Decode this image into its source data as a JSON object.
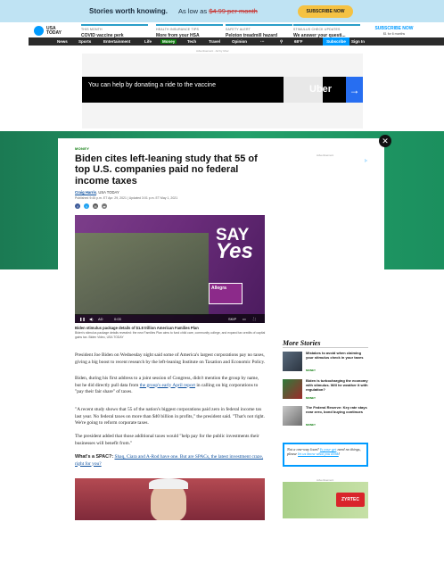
{
  "promo": {
    "headline": "Stories worth knowing.",
    "price_prefix": "As low as",
    "price": "$4.99 per month",
    "cta": "SUBSCRIBE NOW"
  },
  "header": {
    "logo_text": "USA TODAY",
    "headlines": [
      {
        "kicker": "THIS MONTH",
        "title": "COVID vaccine perk"
      },
      {
        "kicker": "HEALTH INSURANCE TIPS",
        "title": "More from your HSA"
      },
      {
        "kicker": "SAFETY ALERT",
        "title": "Peloton treadmill hazard"
      },
      {
        "kicker": "STIMULUS CHECK UPDATES",
        "title": "We answer your questi..."
      }
    ],
    "subscribe_label": "SUBSCRIBE NOW",
    "subscribe_price": "$1 for 6 months"
  },
  "nav": {
    "items": [
      "News",
      "Sports",
      "Entertainment",
      "Life",
      "Money",
      "Tech",
      "Travel",
      "Opinion"
    ],
    "weather": "68°F",
    "subscribe": "Subscribe",
    "sign_in": "Sign In"
  },
  "ad_top": {
    "label": "Advertisement · Ad by Uber",
    "copy": "You can help by donating a ride to the vaccine",
    "brand": "Uber",
    "arrow": "→"
  },
  "article": {
    "section": "MONEY",
    "title": "Biden cites left-leaning study that 55 of top U.S. companies paid no federal income taxes",
    "author": "Craig Harris",
    "outlet": "USA TODAY",
    "dateline": "Published 9:45 p.m. ET Apr. 29, 2021 | Updated 3:01 p.m. ET May 1, 2021",
    "video": {
      "say": "SAY",
      "yes": "Yes",
      "brand": "Allegra",
      "caption_title": "Biden stimulus package details of $1.8 trillion American Families Plan",
      "caption_text": "Biden's stimulus package details revealed: the new Families Plan aims to fund child care, community college, and expand tax credits of capital gains tax. Biden Video, USA TODAY",
      "skip": "SKIP"
    },
    "paragraphs": [
      "President Joe Biden on Wednesday night said some of America's largest corporations pay no taxes, giving a big boost to recent research by the left-leaning Institute on Taxation and Economic Policy.",
      "Biden, during his first address to a joint session of Congress, didn't mention the group by name, but he did directly pull data from the group's early April report in calling on big corporations to \"pay their fair share\" of taxes.",
      "\"A recent study shows that 55 of the nation's biggest corporations paid zero in federal income tax last year. No federal taxes on more than $40 billion in profits,\" the president said. \"That's not right. We're going to reform corporate taxes.",
      "The president added that those additional taxes would \"help pay for the public investments their businesses will benefit from.\""
    ],
    "p2_before": "Biden, during his first address to a joint session of Congress, didn't mention the group by name, but he did directly pull data from ",
    "p2_link": "the group's early April report",
    "p2_after": " in calling on big corporations to \"pay their fair share\" of taxes.",
    "spac_question": "What's a SPAC?:",
    "spac_link": "Shaq, Ciara and A-Rod have one. But are SPACs, the latest investment craze, right for you?"
  },
  "sidebar": {
    "ad_label": "Advertisement",
    "more_title": "More Stories",
    "stories": [
      {
        "title": "Mistakes to avoid when claiming your stimulus check in your taxes",
        "tag": "MONEY"
      },
      {
        "title": "Biden is turbocharging the economy with stimulus. Will he weather it with regulation?",
        "tag": "MONEY"
      },
      {
        "title": "The Federal Reserve: Key rate stays near zero, bond buying continues",
        "tag": "MONEY"
      }
    ],
    "promo_before": "Not a one-way loan? ",
    "promo_link_1": "Is your get",
    "promo_mid": " need no things, please ",
    "promo_link_2": "let us know what you think",
    "promo_after": "!",
    "ad2_label": "Advertisement",
    "ad2_brand": "ZYRTEC"
  },
  "colors": {
    "accent": "#009bff",
    "money_green": "#0b7a0b",
    "band_green": "#23a06a"
  }
}
